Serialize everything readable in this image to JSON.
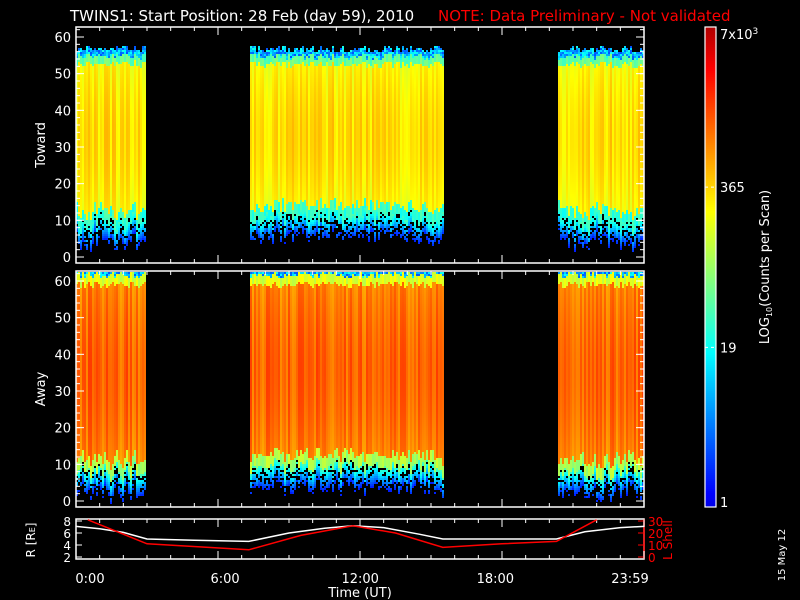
{
  "title": {
    "main": "TWINS1: Start Position: 28 Feb (day  59), 2010",
    "note": "NOTE: Data Preliminary - Not validated",
    "note_color": "#ff0000"
  },
  "date_stamp": "15 May 12",
  "chart_data": [
    {
      "type": "heatmap",
      "name": "Toward",
      "ylabel": "Toward",
      "ylim": [
        0,
        62
      ],
      "yticks": [
        "0",
        "10",
        "20",
        "30",
        "40",
        "50",
        "60"
      ],
      "xlim_hours": [
        0,
        24
      ],
      "data_intervals_hours": [
        [
          0,
          2.9
        ],
        [
          7.3,
          15.5
        ],
        [
          20.3,
          24
        ]
      ],
      "band_low": 11,
      "band_high": 55,
      "level": 0.62
    },
    {
      "type": "heatmap",
      "name": "Away",
      "ylabel": "Away",
      "ylim": [
        0,
        62
      ],
      "yticks": [
        "0",
        "10",
        "20",
        "30",
        "40",
        "50",
        "60"
      ],
      "xlim_hours": [
        0,
        24
      ],
      "data_intervals_hours": [
        [
          0,
          2.9
        ],
        [
          7.3,
          15.5
        ],
        [
          20.3,
          24
        ]
      ],
      "band_low": 9,
      "band_high": 62,
      "level": 0.74
    },
    {
      "type": "line",
      "name": "Orbit",
      "ylabel_left": "R [R",
      "ylabel_left_sub": "E",
      "ylabel_left_end": "]",
      "ylabel_right": "L Shell",
      "ylim_left": [
        2,
        8
      ],
      "ylim_right": [
        0,
        30
      ],
      "yticks_left": [
        "2",
        "4",
        "6",
        "8"
      ],
      "yticks_right": [
        "0",
        "10",
        "20",
        "30"
      ],
      "xlabel": "Time (UT)",
      "xticks": [
        {
          "hour": 0,
          "label": "0:00"
        },
        {
          "hour": 6,
          "label": "6:00"
        },
        {
          "hour": 12,
          "label": "12:00"
        },
        {
          "hour": 18,
          "label": "18:00"
        },
        {
          "hour": 23.98,
          "label": "23:59"
        }
      ],
      "series": [
        {
          "name": "R",
          "axis": "left",
          "color": "#ffffff",
          "x": [
            0,
            1,
            2,
            3,
            5,
            7.3,
            9,
            10.5,
            11.7,
            13,
            14.5,
            15.5,
            18,
            20.3,
            21.5,
            23,
            24
          ],
          "y": [
            7.1,
            6.7,
            6.1,
            5.0,
            4.8,
            4.6,
            6.0,
            6.8,
            7.2,
            6.9,
            5.8,
            5.0,
            5.0,
            5.0,
            6.2,
            6.9,
            7.1
          ]
        },
        {
          "name": "L Shell",
          "axis": "right",
          "color": "#ff0000",
          "x": [
            0.5,
            3,
            7.3,
            9.5,
            11.7,
            13.5,
            15.5,
            18,
            20.3,
            22
          ],
          "y": [
            31,
            11,
            6,
            18,
            26,
            20,
            8,
            11,
            13,
            31
          ]
        }
      ]
    },
    {
      "type": "colorbar",
      "label": "LOG10(Counts per Scan)",
      "label_pre": "LOG",
      "label_sub": "10",
      "label_post": "(Counts per Scan)",
      "ticks": [
        {
          "value": 7000,
          "label": "7x10",
          "sup": "3"
        },
        {
          "value": 365,
          "label": "365"
        },
        {
          "value": 19,
          "label": "19"
        },
        {
          "value": 1,
          "label": "1"
        }
      ],
      "range": [
        1,
        7000
      ]
    }
  ]
}
